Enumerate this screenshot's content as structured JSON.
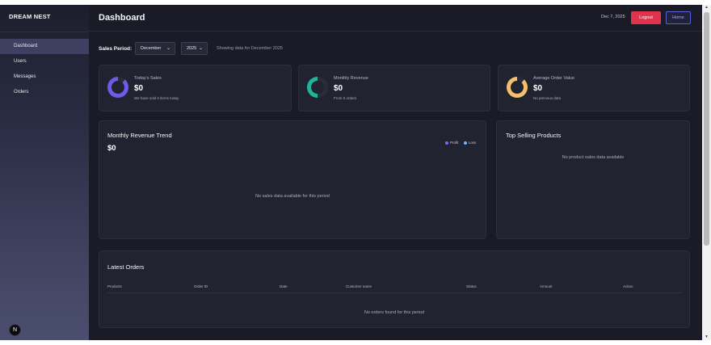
{
  "sidebar": {
    "brand": "DREAM NEST",
    "items": [
      {
        "label": "Dashboard",
        "active": true
      },
      {
        "label": "Users"
      },
      {
        "label": "Messages"
      },
      {
        "label": "Orders"
      }
    ],
    "logo_letter": "N"
  },
  "header": {
    "title": "Dashboard",
    "date": "Dec 7, 2025",
    "logout_label": "Logout",
    "home_label": "Home"
  },
  "filters": {
    "label": "Sales Period:",
    "month": "December",
    "year": "2025",
    "showing_text": "Showing data for December 2025"
  },
  "stats": [
    {
      "label": "Today's Sales",
      "value": "$0",
      "sub": "We have sold 0 items today",
      "color": "#6d5ce8"
    },
    {
      "label": "Monthly Revenue",
      "value": "$0",
      "sub": "From 0 orders",
      "color": "#1fb59a"
    },
    {
      "label": "Average Order Value",
      "value": "$0",
      "sub": "No previous data",
      "color": "#f4c06c"
    }
  ],
  "revenue_trend": {
    "title": "Monthly Revenue Trend",
    "value": "$0",
    "legend": [
      {
        "label": "Profit",
        "color": "#7c6cf0"
      },
      {
        "label": "Loss",
        "color": "#7ab3f5"
      }
    ],
    "empty_text": "No sales data available for this period"
  },
  "top_selling": {
    "title": "Top Selling Products",
    "empty_text": "No product sales data available"
  },
  "orders": {
    "title": "Latest Orders",
    "columns": [
      "Products",
      "Order ID",
      "Date",
      "Customer name",
      "Status",
      "Amount",
      "Action"
    ],
    "empty_text": "No orders found for this period"
  }
}
